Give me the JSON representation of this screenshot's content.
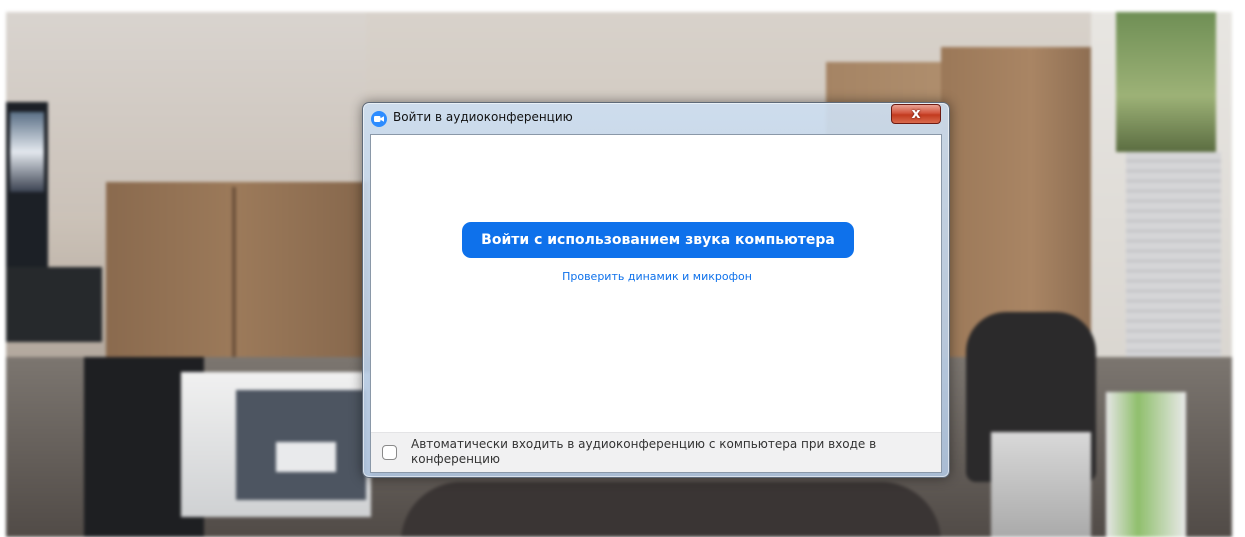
{
  "dialog": {
    "title": "Войти в аудиоконференцию",
    "close_label": "x",
    "app_icon": "zoom-camera-icon"
  },
  "main": {
    "join_button_label": "Войти с использованием звука компьютера",
    "test_link_label": "Проверить динамик и микрофон"
  },
  "footer": {
    "auto_join_label": "Автоматически входить в аудиоконференцию с компьютера при входе в конференцию",
    "auto_join_checked": false
  },
  "colors": {
    "accent_blue": "#0e71eb",
    "close_red": "#c23a1f",
    "footer_bg": "#f1f1f2"
  }
}
